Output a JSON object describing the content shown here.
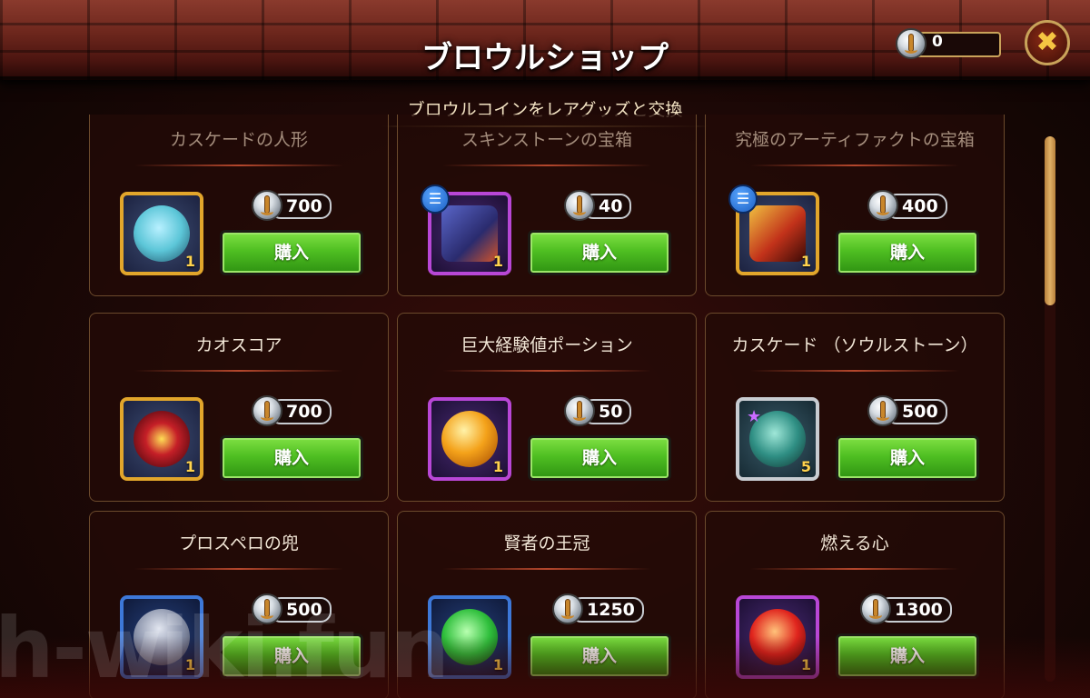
{
  "header": {
    "title": "ブロウルショップ",
    "subtitle": "ブロウルコインをレアグッズと交換",
    "currency_value": "0",
    "close_icon": "✖"
  },
  "buy_label": "購入",
  "items": [
    {
      "name": "カスケードの人形",
      "price": "700",
      "qty": "1",
      "frame": "gold",
      "art_color": "#5cc6d8",
      "info_badge": false,
      "star": false
    },
    {
      "name": "スキンストーンの宝箱",
      "price": "40",
      "qty": "1",
      "frame": "purple",
      "art_color": "#3b3d8e",
      "info_badge": true,
      "star": false
    },
    {
      "name": "究極のアーティファクトの宝箱",
      "price": "400",
      "qty": "1",
      "frame": "gold",
      "art_color": "#c2321a",
      "info_badge": true,
      "star": false
    },
    {
      "name": "カオスコア",
      "price": "700",
      "qty": "1",
      "frame": "gold",
      "art_color": "#c51f27",
      "info_badge": false,
      "star": false
    },
    {
      "name": "巨大経験値ポーション",
      "price": "50",
      "qty": "1",
      "frame": "purple",
      "art_color": "#f4a21a",
      "info_badge": false,
      "star": false
    },
    {
      "name": "カスケード （ソウルストーン）",
      "price": "500",
      "qty": "5",
      "frame": "silver",
      "art_color": "#2f8f84",
      "info_badge": false,
      "star": true
    },
    {
      "name": "プロスペロの兜",
      "price": "500",
      "qty": "1",
      "frame": "blue",
      "art_color": "#8790a8",
      "info_badge": false,
      "star": false
    },
    {
      "name": "賢者の王冠",
      "price": "1250",
      "qty": "1",
      "frame": "blue",
      "art_color": "#2fbf3c",
      "info_badge": false,
      "star": false
    },
    {
      "name": "燃える心",
      "price": "1300",
      "qty": "1",
      "frame": "purple",
      "art_color": "#e0241d",
      "info_badge": false,
      "star": false
    }
  ],
  "watermark": "h-wiki.fun"
}
